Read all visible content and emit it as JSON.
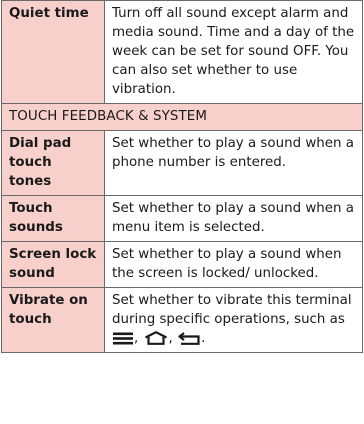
{
  "rows": [
    {
      "name": "Quiet time",
      "description": "Turn off all sound except alarm and media sound. Time and a day of the week can be set for sound OFF. You can also set whether to use vibration."
    }
  ],
  "section": {
    "title": "TOUCH FEEDBACK & SYSTEM"
  },
  "section_rows": [
    {
      "name": "Dial pad touch tones",
      "description": "Set whether to play a sound when a phone number is entered."
    },
    {
      "name": "Touch sounds",
      "description": "Set whether to play a sound when a menu item is selected."
    },
    {
      "name": "Screen lock sound",
      "description": "Set whether to play a sound when the screen is locked/ unlocked."
    },
    {
      "name": "Vibrate on touch",
      "description_prefix": "Set whether to vibrate this terminal during specific operations, such as",
      "separator_1": ",",
      "separator_2": ",",
      "description_suffix": ".",
      "icons": [
        "menu-icon",
        "home-icon",
        "back-icon"
      ]
    }
  ]
}
